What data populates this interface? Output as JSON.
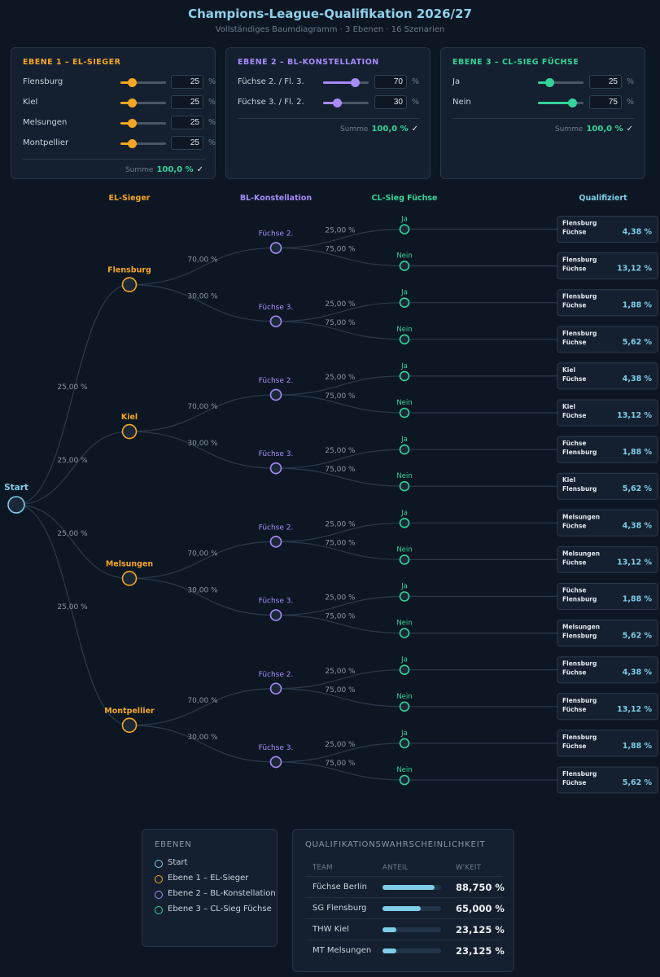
{
  "header": {
    "title": "Champions-League-Qualifikation 2026/27",
    "subtitle": "Vollständiges Baumdiagramm · 3 Ebenen · 16 Szenarien"
  },
  "colors": {
    "el": "#f5a623",
    "bl": "#a78bfa",
    "cl": "#34d399",
    "start": "#7ecde9",
    "text_dim": "#6d7c8c"
  },
  "panels": [
    {
      "title": "EBENE 1 – EL-SIEGER",
      "color": "#f5a623",
      "rows": [
        {
          "label": "Flensburg",
          "value": "25",
          "fraction": 0.25
        },
        {
          "label": "Kiel",
          "value": "25",
          "fraction": 0.25
        },
        {
          "label": "Melsungen",
          "value": "25",
          "fraction": 0.25
        },
        {
          "label": "Montpellier",
          "value": "25",
          "fraction": 0.25
        }
      ],
      "unit": "%",
      "sum_label": "Summe",
      "sum_value": "100,0 %",
      "sum_check": "✓"
    },
    {
      "title": "EBENE 2 – BL-KONSTELLATION",
      "color": "#a78bfa",
      "rows": [
        {
          "label": "Füchse 2. / Fl. 3.",
          "value": "70",
          "fraction": 0.7
        },
        {
          "label": "Füchse 3. / Fl. 2.",
          "value": "30",
          "fraction": 0.3
        }
      ],
      "unit": "%",
      "sum_label": "Summe",
      "sum_value": "100,0 %",
      "sum_check": "✓"
    },
    {
      "title": "EBENE 3 – CL-SIEG FÜCHSE",
      "color": "#34d399",
      "rows": [
        {
          "label": "Ja",
          "value": "25",
          "fraction": 0.25
        },
        {
          "label": "Nein",
          "value": "75",
          "fraction": 0.75
        }
      ],
      "unit": "%",
      "sum_label": "Summe",
      "sum_value": "100,0 %",
      "sum_check": "✓"
    }
  ],
  "tree": {
    "column_headers": [
      "EL-Sieger",
      "BL-Konstellation",
      "CL-Sieg Füchse",
      "Qualifiziert"
    ],
    "start_label": "Start",
    "el_probs": [
      "25,00 %",
      "25,00 %",
      "25,00 %",
      "25,00 %"
    ],
    "bl_probs": [
      "70,00 %",
      "30,00 %"
    ],
    "cl_probs": [
      "25,00 %",
      "75,00 %"
    ],
    "el_nodes": [
      "Flensburg",
      "Kiel",
      "Melsungen",
      "Montpellier"
    ],
    "bl_nodes": [
      "Füchse 2.",
      "Füchse 3."
    ],
    "cl_nodes": [
      "Ja",
      "Nein"
    ],
    "outcomes": [
      {
        "teams": [
          "Flensburg",
          "Füchse"
        ],
        "value": "4,38 %"
      },
      {
        "teams": [
          "Flensburg",
          "Füchse"
        ],
        "value": "13,12 %"
      },
      {
        "teams": [
          "Flensburg",
          "Füchse"
        ],
        "value": "1,88 %"
      },
      {
        "teams": [
          "Flensburg",
          "Füchse"
        ],
        "value": "5,62 %"
      },
      {
        "teams": [
          "Kiel",
          "Füchse"
        ],
        "value": "4,38 %"
      },
      {
        "teams": [
          "Kiel",
          "Füchse"
        ],
        "value": "13,12 %"
      },
      {
        "teams": [
          "Füchse",
          "Flensburg"
        ],
        "value": "1,88 %"
      },
      {
        "teams": [
          "Kiel",
          "Flensburg"
        ],
        "value": "5,62 %"
      },
      {
        "teams": [
          "Melsungen",
          "Füchse"
        ],
        "value": "4,38 %"
      },
      {
        "teams": [
          "Melsungen",
          "Füchse"
        ],
        "value": "13,12 %"
      },
      {
        "teams": [
          "Füchse",
          "Flensburg"
        ],
        "value": "1,88 %"
      },
      {
        "teams": [
          "Melsungen",
          "Flensburg"
        ],
        "value": "5,62 %"
      },
      {
        "teams": [
          "Flensburg",
          "Füchse"
        ],
        "value": "4,38 %"
      },
      {
        "teams": [
          "Flensburg",
          "Füchse"
        ],
        "value": "13,12 %"
      },
      {
        "teams": [
          "Flensburg",
          "Füchse"
        ],
        "value": "1,88 %"
      },
      {
        "teams": [
          "Flensburg",
          "Füchse"
        ],
        "value": "5,62 %"
      }
    ]
  },
  "legend": {
    "title": "EBENEN",
    "items": [
      {
        "label": "Start",
        "color": "#7ecde9"
      },
      {
        "label": "Ebene 1 – EL-Sieger",
        "color": "#f5a623"
      },
      {
        "label": "Ebene 2 – BL-Konstellation",
        "color": "#a78bfa"
      },
      {
        "label": "Ebene 3 – CL-Sieg Füchse",
        "color": "#34d399"
      }
    ]
  },
  "qualification": {
    "title": "QUALIFIKATIONSWAHRSCHEINLICHKEIT",
    "headers": [
      "TEAM",
      "ANTEIL",
      "W'KEIT"
    ],
    "rows": [
      {
        "team": "Füchse Berlin",
        "value": "88,750 %",
        "fraction": 0.8875
      },
      {
        "team": "SG Flensburg",
        "value": "65,000 %",
        "fraction": 0.65
      },
      {
        "team": "THW Kiel",
        "value": "23,125 %",
        "fraction": 0.23125
      },
      {
        "team": "MT Melsungen",
        "value": "23,125 %",
        "fraction": 0.23125
      }
    ]
  }
}
